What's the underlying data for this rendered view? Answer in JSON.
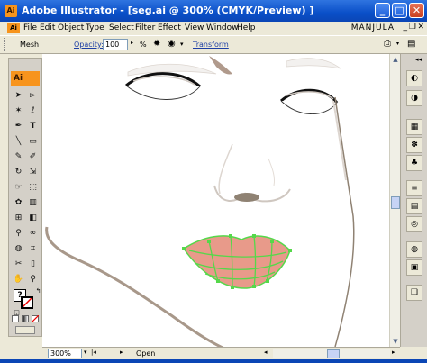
{
  "window": {
    "title": "Adobe Illustrator - [seg.ai @ 300% (CMYK/Preview) ]",
    "app_icon": "Ai",
    "minimize": "_",
    "maximize": "□",
    "close": "✕"
  },
  "menu": {
    "items": [
      "File",
      "Edit",
      "Object",
      "Type",
      "Select",
      "Filter",
      "Effect",
      "View",
      "Window",
      "Help"
    ],
    "brand": "MANJULA"
  },
  "control": {
    "tool_label": "Mesh",
    "opacity_label": "Opacity:",
    "opacity_value": "100",
    "percent": "%",
    "transform_label": "Transform"
  },
  "toolbox": {
    "badge": "Ai",
    "tools": [
      "selection-tool",
      "direct-selection-tool",
      "magic-wand-tool",
      "lasso-tool",
      "pen-tool",
      "type-tool",
      "line-tool",
      "rectangle-tool",
      "paintbrush-tool",
      "pencil-tool",
      "rotate-tool",
      "scale-tool",
      "warp-tool",
      "free-transform-tool",
      "symbol-sprayer-tool",
      "column-graph-tool",
      "mesh-tool",
      "gradient-tool",
      "eyedropper-tool",
      "blend-tool",
      "live-paint-tool",
      "slice-tool",
      "scissors-tool",
      "eraser-tool",
      "hand-tool",
      "zoom-tool"
    ]
  },
  "status": {
    "zoom": "300%",
    "state": "Open"
  },
  "colors": {
    "lip_fill": "#e89a8a",
    "mesh_lines": "#55d84a",
    "face_outline": "#a8988a",
    "brows": "#b09a8c"
  }
}
